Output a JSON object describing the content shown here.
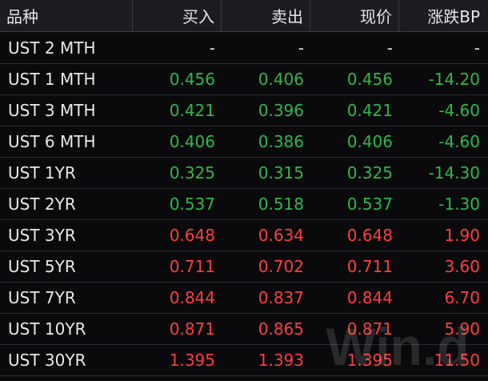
{
  "table": {
    "columns": {
      "name": "品种",
      "bid": "买入",
      "ask": "卖出",
      "last": "现价",
      "change": "涨跌BP"
    },
    "rows": [
      {
        "name": "UST 2 MTH",
        "bid": "-",
        "ask": "-",
        "last": "-",
        "change": "-",
        "trend": "flat"
      },
      {
        "name": "UST 1 MTH",
        "bid": "0.456",
        "ask": "0.406",
        "last": "0.456",
        "change": "-14.20",
        "trend": "down"
      },
      {
        "name": "UST 3 MTH",
        "bid": "0.421",
        "ask": "0.396",
        "last": "0.421",
        "change": "-4.60",
        "trend": "down"
      },
      {
        "name": "UST 6 MTH",
        "bid": "0.406",
        "ask": "0.386",
        "last": "0.406",
        "change": "-4.60",
        "trend": "down"
      },
      {
        "name": "UST 1YR",
        "bid": "0.325",
        "ask": "0.315",
        "last": "0.325",
        "change": "-14.30",
        "trend": "down"
      },
      {
        "name": "UST 2YR",
        "bid": "0.537",
        "ask": "0.518",
        "last": "0.537",
        "change": "-1.30",
        "trend": "down"
      },
      {
        "name": "UST 3YR",
        "bid": "0.648",
        "ask": "0.634",
        "last": "0.648",
        "change": "1.90",
        "trend": "up"
      },
      {
        "name": "UST 5YR",
        "bid": "0.711",
        "ask": "0.702",
        "last": "0.711",
        "change": "3.60",
        "trend": "up"
      },
      {
        "name": "UST 7YR",
        "bid": "0.844",
        "ask": "0.837",
        "last": "0.844",
        "change": "6.70",
        "trend": "up"
      },
      {
        "name": "UST 10YR",
        "bid": "0.871",
        "ask": "0.865",
        "last": "0.871",
        "change": "5.90",
        "trend": "up"
      },
      {
        "name": "UST 30YR",
        "bid": "1.395",
        "ask": "1.393",
        "last": "1.395",
        "change": "11.50",
        "trend": "up"
      }
    ]
  },
  "watermark": {
    "text": "Win.d"
  },
  "colors": {
    "up": "#ff3d3d",
    "down": "#2fb84a",
    "flat": "#e0e0e0",
    "header_bg": "#1c1c21",
    "body_bg": "#0a0a0c"
  }
}
